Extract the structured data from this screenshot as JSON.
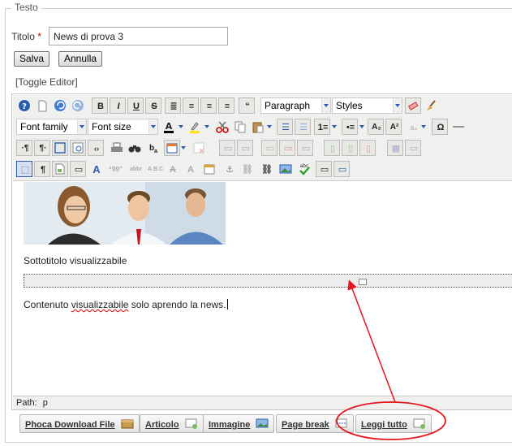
{
  "fieldset": {
    "legend": "Testo"
  },
  "form": {
    "title_label": "Titolo",
    "title_required": "*",
    "title_value": "News di prova 3",
    "save_label": "Salva",
    "cancel_label": "Annulla",
    "toggle_editor": "[Toggle Editor]"
  },
  "toolbar": {
    "format_select": "Paragraph",
    "styles_select": "Styles",
    "font_family_select": "Font family",
    "font_size_select": "Font size"
  },
  "content": {
    "subtitle": "Sottotitolo visualizzabile",
    "body_prefix": "Contenuto ",
    "body_misspelled": "visualizzabile",
    "body_suffix": " solo aprendo la news."
  },
  "statusbar": {
    "path_label": "Path:",
    "path_value": "p"
  },
  "extra_buttons": [
    {
      "label": "Phoca Download File",
      "icon": "phoca-box-icon"
    },
    {
      "label": "Articolo",
      "icon": "article-icon"
    },
    {
      "label": "Immagine",
      "icon": "image-icon"
    },
    {
      "label": "Page break",
      "icon": "pagebreak-icon"
    },
    {
      "label": "Leggi tutto",
      "icon": "readmore-icon"
    }
  ],
  "colors": {
    "annotation": "#e8141e",
    "toolbar_bg": "#f0f0ee",
    "accent_blue": "#2a5db0"
  }
}
